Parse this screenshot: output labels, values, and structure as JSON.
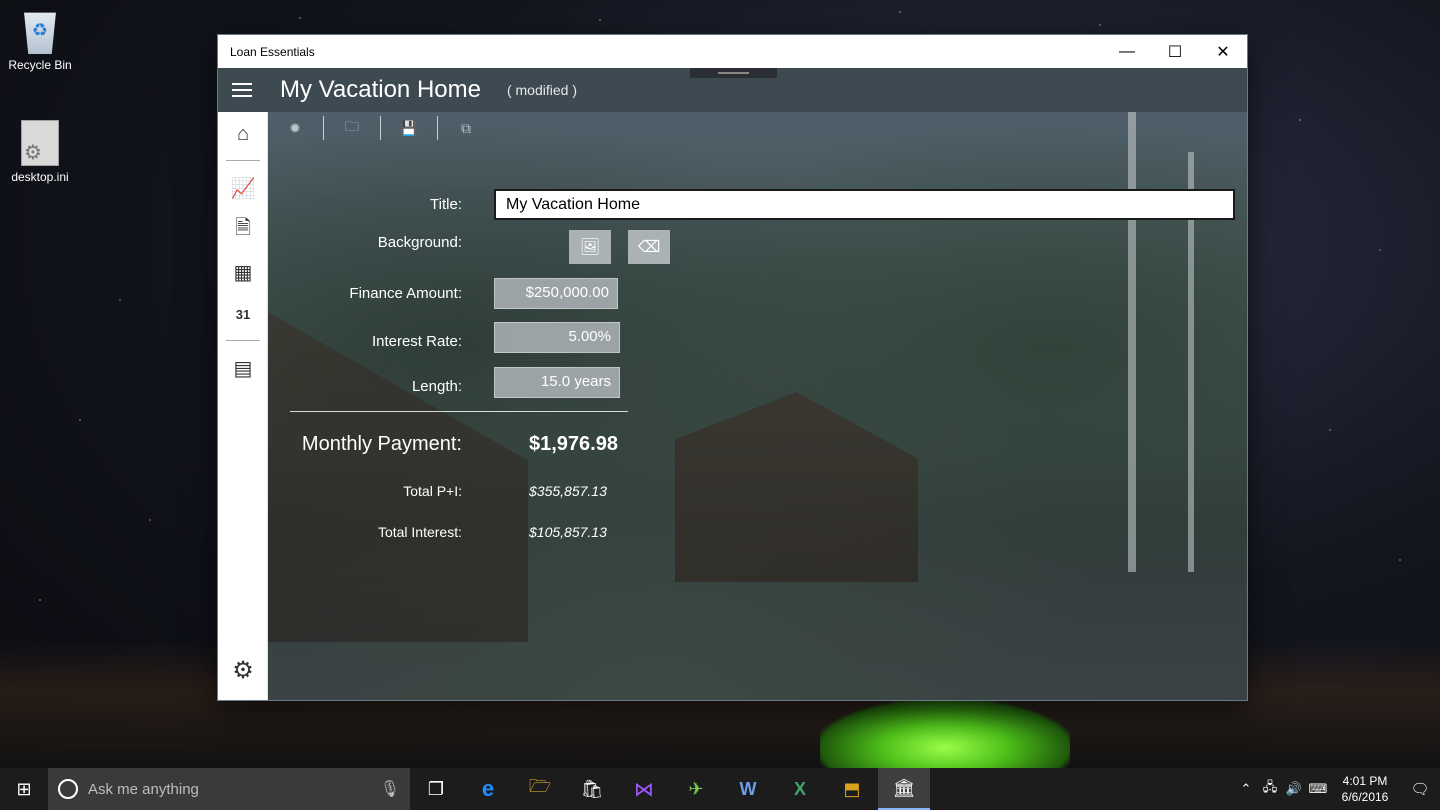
{
  "desktop": {
    "icons": [
      {
        "label": "Recycle Bin",
        "icon": "recycle-bin-icon"
      },
      {
        "label": "desktop.ini",
        "icon": "settings-file-icon"
      }
    ]
  },
  "window": {
    "title": "Loan Essentials",
    "controls": {
      "minimize": "—",
      "maximize": "☐",
      "close": "✕"
    }
  },
  "appbar": {
    "doc_title": "My Vacation Home",
    "status": "( modified )"
  },
  "nav": [
    {
      "name": "home",
      "icon": "home-icon",
      "glyph": "⌂"
    },
    {
      "name": "charts",
      "icon": "chart-icon",
      "glyph": "📈"
    },
    {
      "name": "report",
      "icon": "report-search-icon",
      "glyph": "🗎"
    },
    {
      "name": "schedule",
      "icon": "calendar-icon",
      "glyph": "▦"
    },
    {
      "name": "date",
      "icon": "calendar-date-icon",
      "glyph": "31"
    },
    {
      "name": "calculator",
      "icon": "calculator-icon",
      "glyph": "▤"
    },
    {
      "name": "settings",
      "icon": "gear-icon",
      "glyph": "⚙"
    }
  ],
  "toolbar": [
    {
      "name": "new",
      "icon": "new-icon",
      "glyph": "✹"
    },
    {
      "name": "open",
      "icon": "folder-open-icon",
      "glyph": "🗀"
    },
    {
      "name": "save",
      "icon": "save-icon",
      "glyph": "💾"
    },
    {
      "name": "copy",
      "icon": "copy-icon",
      "glyph": "⧉"
    }
  ],
  "form": {
    "title_label": "Title:",
    "title_value": "My Vacation Home",
    "background_label": "Background:",
    "background_buttons": [
      {
        "name": "image",
        "icon": "image-icon",
        "glyph": "🖼"
      },
      {
        "name": "clear",
        "icon": "eraser-icon",
        "glyph": "⌫"
      }
    ],
    "finance_label": "Finance Amount:",
    "finance_value": "$250,000.00",
    "interest_label": "Interest Rate:",
    "interest_value": "5.00%",
    "length_label": "Length:",
    "length_value": "15.0 years"
  },
  "results": {
    "monthly_label": "Monthly Payment:",
    "monthly_value": "$1,976.98",
    "total_pi_label": "Total P+I:",
    "total_pi_value": "$355,857.13",
    "total_interest_label": "Total Interest:",
    "total_interest_value": "$105,857.13"
  },
  "taskbar": {
    "search_placeholder": "Ask me anything",
    "apps": [
      {
        "name": "task-view",
        "icon": "task-view-icon",
        "glyph": "❐"
      },
      {
        "name": "edge",
        "icon": "edge-icon",
        "glyph": "e",
        "color": "#1e90ff"
      },
      {
        "name": "explorer",
        "icon": "folder-icon",
        "glyph": "🗁",
        "color": "#f4c430"
      },
      {
        "name": "store",
        "icon": "store-icon",
        "glyph": "🛍"
      },
      {
        "name": "visual-studio",
        "icon": "visual-studio-icon",
        "glyph": "⋈",
        "color": "#a259ff"
      },
      {
        "name": "app-bird",
        "icon": "bird-app-icon",
        "glyph": "✈",
        "color": "#7ec850"
      },
      {
        "name": "word",
        "icon": "word-icon",
        "glyph": "W",
        "color": "#2b579a"
      },
      {
        "name": "excel",
        "icon": "excel-icon",
        "glyph": "X",
        "color": "#217346"
      },
      {
        "name": "app-yellow",
        "icon": "yellow-app-icon",
        "glyph": "⬒",
        "color": "#d9a21b"
      },
      {
        "name": "loan-essentials",
        "icon": "bank-icon",
        "glyph": "🏛",
        "active": true
      }
    ],
    "tray": {
      "icons": [
        "⌃",
        "🖧",
        "🔊",
        "🗨"
      ],
      "time": "4:01 PM",
      "date": "6/6/2016"
    }
  }
}
